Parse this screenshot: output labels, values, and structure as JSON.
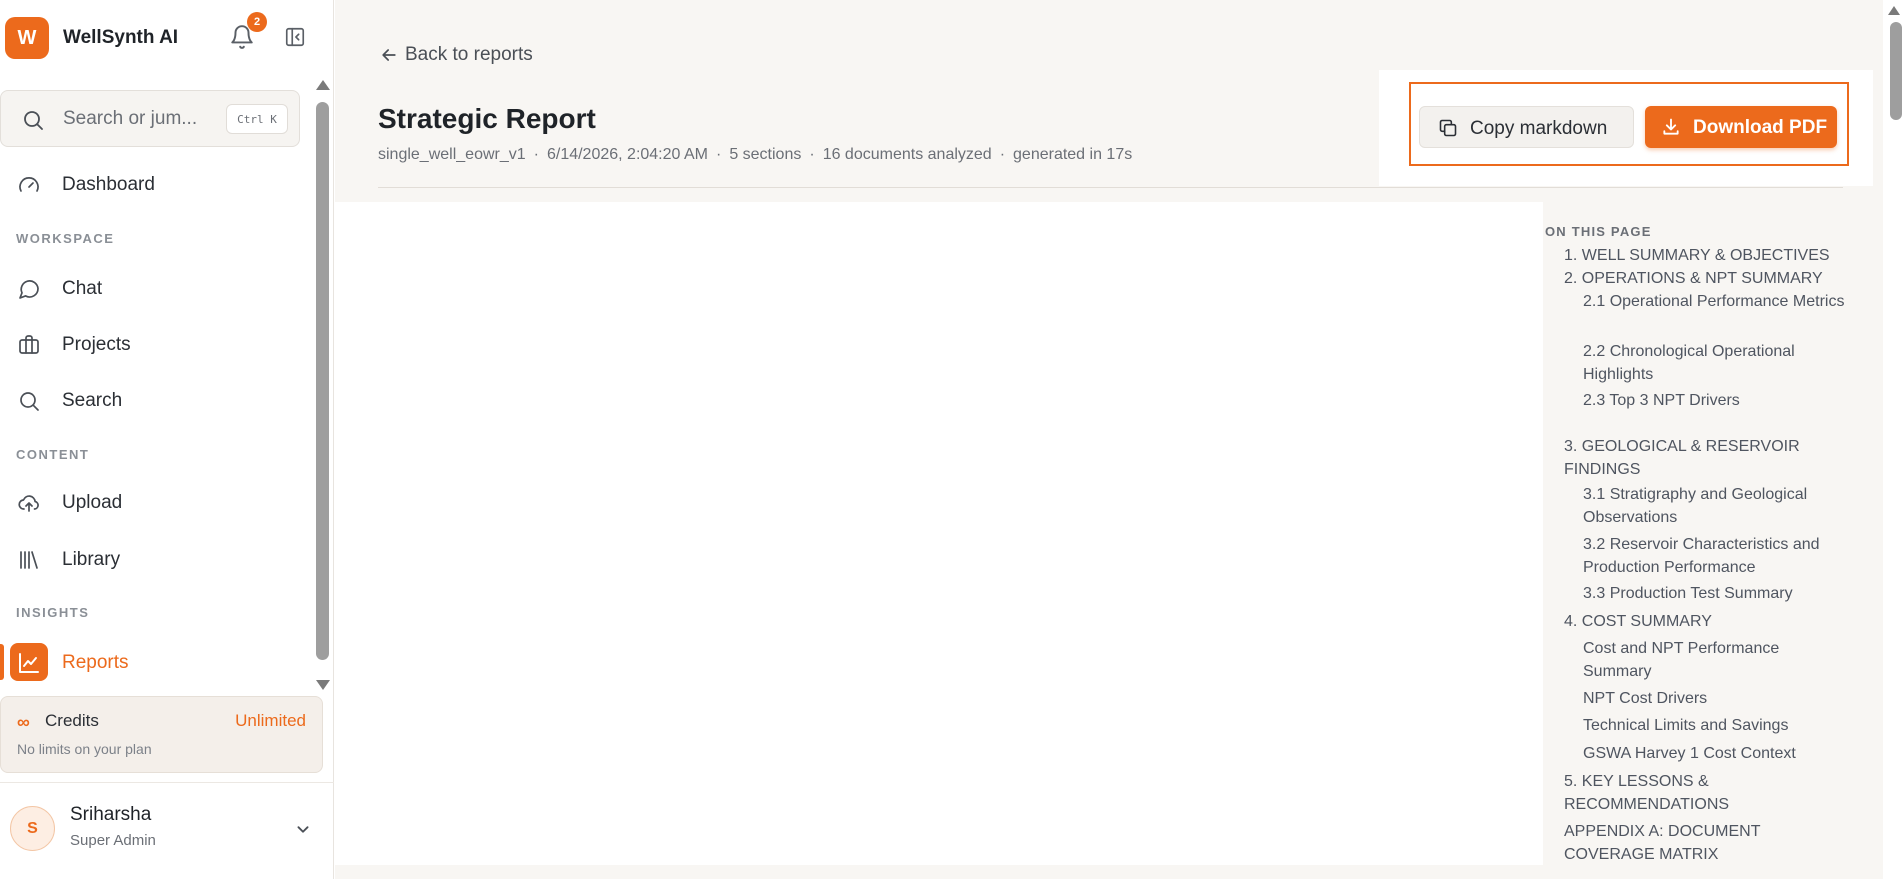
{
  "brand": {
    "logo_letter": "W",
    "name": "WellSynth AI"
  },
  "notifications": {
    "count": "2"
  },
  "search": {
    "placeholder": "Search or jum...",
    "shortcut": "Ctrl K"
  },
  "nav": {
    "dashboard": "Dashboard",
    "section_workspace": "WORKSPACE",
    "chat": "Chat",
    "projects": "Projects",
    "search": "Search",
    "section_content": "CONTENT",
    "upload": "Upload",
    "library": "Library",
    "section_insights": "INSIGHTS",
    "reports": "Reports"
  },
  "credits": {
    "title": "Credits",
    "value": "Unlimited",
    "subtitle": "No limits on your plan",
    "icon": "infinity-icon"
  },
  "user": {
    "initial": "S",
    "name": "Sriharsha",
    "role": "Super Admin"
  },
  "main": {
    "back_label": "Back to reports",
    "title": "Strategic Report",
    "meta": [
      "single_well_eowr_v1",
      "6/14/2026, 2:04:20 AM",
      "5 sections",
      "16 documents analyzed",
      "generated in 17s"
    ],
    "copy_label": "Copy markdown",
    "pdf_label": "Download PDF"
  },
  "toc": {
    "heading": "ON THIS PAGE",
    "items": [
      {
        "level": 1,
        "label": "1. WELL SUMMARY & OBJECTIVES"
      },
      {
        "level": 1,
        "label": "2. OPERATIONS & NPT SUMMARY"
      },
      {
        "level": 2,
        "label": "2.1 Operational Performance Metrics"
      },
      {
        "level": 2,
        "label": "2.2 Chronological Operational Highlights"
      },
      {
        "level": 2,
        "label": "2.3 Top 3 NPT Drivers"
      },
      {
        "level": 1,
        "label": "3. GEOLOGICAL & RESERVOIR FINDINGS"
      },
      {
        "level": 2,
        "label": "3.1 Stratigraphy and Geological Observations"
      },
      {
        "level": 2,
        "label": "3.2 Reservoir Characteristics and Production Performance"
      },
      {
        "level": 2,
        "label": "3.3 Production Test Summary"
      },
      {
        "level": 1,
        "label": "4. COST SUMMARY"
      },
      {
        "level": 2,
        "label": "Cost and NPT Performance Summary"
      },
      {
        "level": 2,
        "label": "NPT Cost Drivers"
      },
      {
        "level": 2,
        "label": "Technical Limits and Savings"
      },
      {
        "level": 2,
        "label": "GSWA Harvey 1 Cost Context"
      },
      {
        "level": 1,
        "label": "5. KEY LESSONS & RECOMMENDATIONS"
      },
      {
        "level": 1,
        "label": "APPENDIX A: DOCUMENT COVERAGE MATRIX"
      }
    ]
  },
  "colors": {
    "accent": "#ec6a1c",
    "sidebar_bg": "#ffffff",
    "main_bg": "#f8f6f3"
  }
}
